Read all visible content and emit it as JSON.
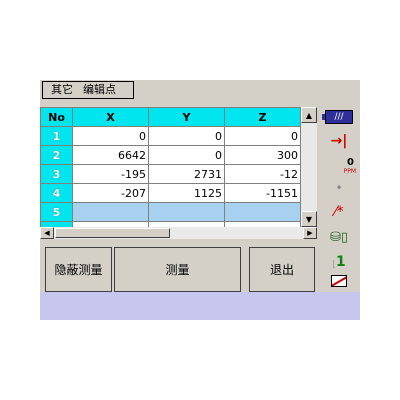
{
  "menu": {
    "items": [
      "其它",
      "编辑点"
    ]
  },
  "table": {
    "headers": [
      "No",
      "X",
      "Y",
      "Z"
    ],
    "rows": [
      {
        "no": "1",
        "x": "0",
        "y": "0",
        "z": "0"
      },
      {
        "no": "2",
        "x": "6642",
        "y": "0",
        "z": "300"
      },
      {
        "no": "3",
        "x": "-195",
        "y": "2731",
        "z": "-12"
      },
      {
        "no": "4",
        "x": "-207",
        "y": "1125",
        "z": "-1151"
      },
      {
        "no": "5",
        "x": "",
        "y": "",
        "z": ""
      }
    ]
  },
  "buttons": {
    "hidden_measure": "隐蔽测量",
    "measure": "测量",
    "exit": "退出"
  },
  "status": {
    "battery_label": "///",
    "ppm_value": "0",
    "ppm_unit": "PPM",
    "face_number": "1"
  },
  "colors": {
    "header_cyan": "#00e5ee",
    "selection_blue": "#a8d0ef",
    "bottom_strip": "#c6c6ef"
  }
}
